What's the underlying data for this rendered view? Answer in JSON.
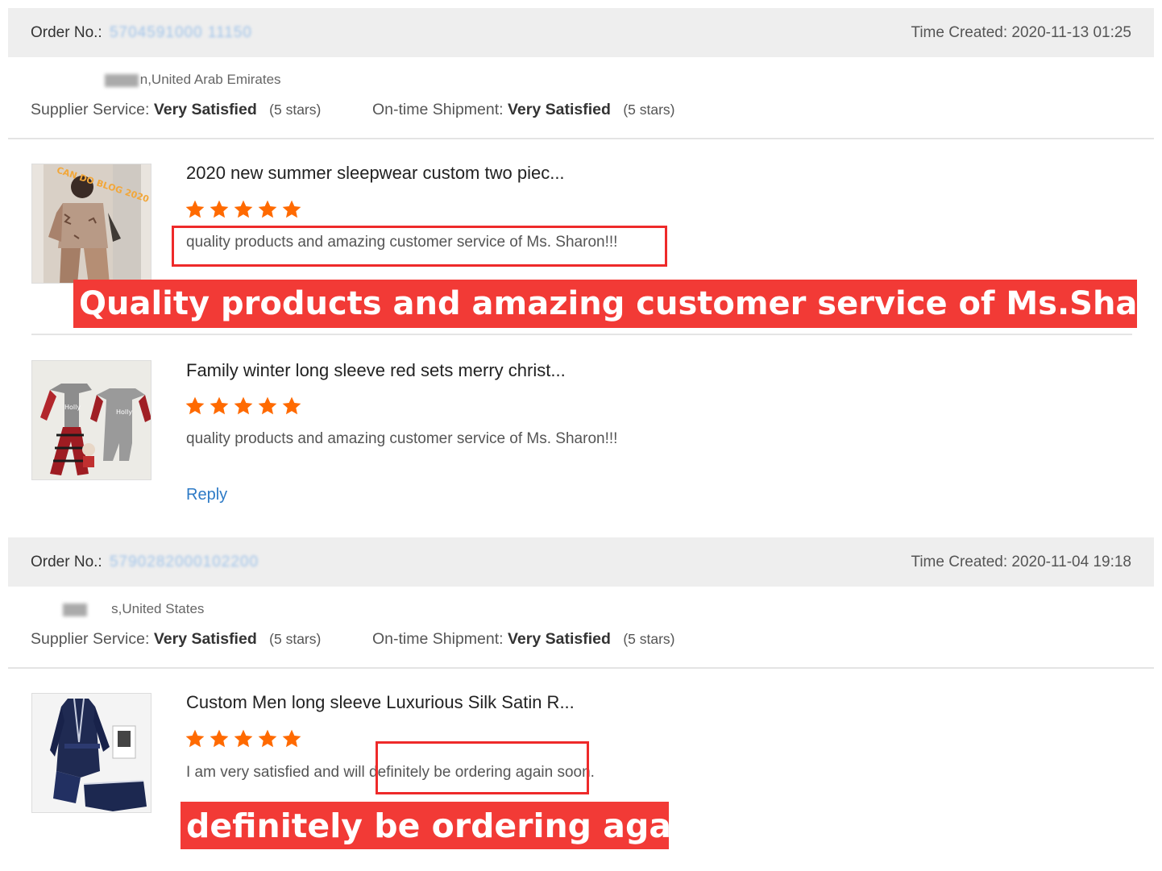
{
  "orders": [
    {
      "order_label": "Order No.:",
      "order_number": "5704591000  11150",
      "time_label": "Time Created:",
      "time_value": "2020-11-13 01:25",
      "buyer_suffix": "n,United Arab Emirates",
      "supplier_label": "Supplier Service:",
      "supplier_value": "Very Satisfied",
      "supplier_stars": "(5 stars)",
      "shipment_label": "On-time Shipment:",
      "shipment_value": "Very Satisfied",
      "shipment_stars": "(5 stars)",
      "items": [
        {
          "title": "2020 new summer sleepwear custom two piec...",
          "rating": 5,
          "review": "quality products and amazing customer service of Ms. Sharon!!!"
        },
        {
          "title": "Family winter long sleeve red sets merry christ...",
          "rating": 5,
          "review": "quality products and amazing customer service of Ms. Sharon!!!",
          "reply_label": "Reply"
        }
      ]
    },
    {
      "order_label": "Order No.:",
      "order_number": "5790282000102200",
      "time_label": "Time Created:",
      "time_value": "2020-11-04 19:18",
      "buyer_suffix": "s,United States",
      "supplier_label": "Supplier Service:",
      "supplier_value": "Very Satisfied",
      "supplier_stars": "(5 stars)",
      "shipment_label": "On-time Shipment:",
      "shipment_value": "Very Satisfied",
      "shipment_stars": "(5 stars)",
      "items": [
        {
          "title": "Custom Men long sleeve Luxurious Silk Satin R...",
          "rating": 5,
          "review": "I am very satisfied and will definitely be ordering again soon."
        }
      ]
    }
  ],
  "annotations": {
    "banner1": "Quality products and amazing customer service of Ms.Sharon",
    "banner2": "definitely be ordering again"
  },
  "colors": {
    "star": "#ff6a00",
    "highlight": "#ee2a2a",
    "banner": "#f23a36",
    "link": "#2d7ac6",
    "header_bg": "#eeeeee"
  }
}
